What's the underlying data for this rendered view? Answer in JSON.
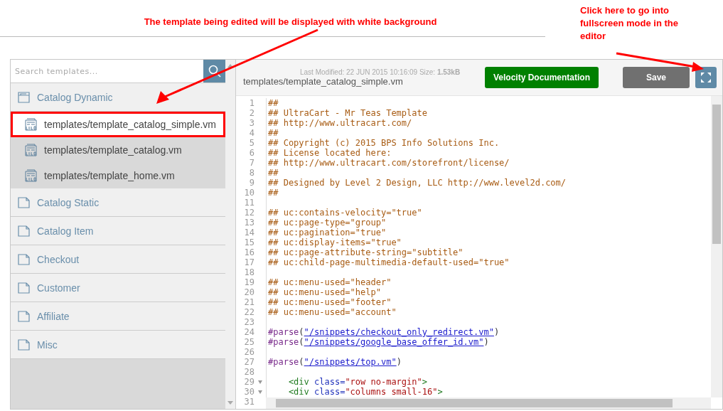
{
  "annotations": [
    {
      "text": "The template being edited will be displayed with white background"
    },
    {
      "text": "Click here to go into fullscreen mode in the editor"
    }
  ],
  "search": {
    "placeholder": "Search templates..."
  },
  "tree": [
    {
      "label": "Catalog Dynamic",
      "expanded": true,
      "children": [
        {
          "label": "templates/template_catalog_simple.vm",
          "selected": true,
          "annotated": true
        },
        {
          "label": "templates/template_catalog.vm",
          "selected": false,
          "annotated": false
        },
        {
          "label": "templates/template_home.vm",
          "selected": false,
          "annotated": false
        }
      ]
    },
    {
      "label": "Catalog Static",
      "expanded": false
    },
    {
      "label": "Catalog Item",
      "expanded": false
    },
    {
      "label": "Checkout",
      "expanded": false
    },
    {
      "label": "Customer",
      "expanded": false
    },
    {
      "label": "Affiliate",
      "expanded": false
    },
    {
      "label": "Misc",
      "expanded": false
    }
  ],
  "editor": {
    "path": "templates/template_catalog_simple.vm",
    "meta": "Last Modified: 22 JUN 2015 10:16:09  Size: **1.53kB**",
    "buttons": [
      {
        "label": "Velocity Documentation",
        "kind": "primary"
      },
      {
        "label": "Save",
        "kind": "secondary"
      }
    ],
    "lines": [
      {
        "number": "1",
        "fold": false,
        "segments": [
          {
            "kind": "comment",
            "text": "##"
          }
        ]
      },
      {
        "number": "2",
        "fold": false,
        "segments": [
          {
            "kind": "comment",
            "text": "## UltraCart - Mr Teas Template"
          }
        ]
      },
      {
        "number": "3",
        "fold": false,
        "segments": [
          {
            "kind": "comment",
            "text": "## http://www.ultracart.com/"
          }
        ]
      },
      {
        "number": "4",
        "fold": false,
        "segments": [
          {
            "kind": "comment",
            "text": "##"
          }
        ]
      },
      {
        "number": "5",
        "fold": false,
        "segments": [
          {
            "kind": "comment",
            "text": "## Copyright (c) 2015 BPS Info Solutions Inc."
          }
        ]
      },
      {
        "number": "6",
        "fold": false,
        "segments": [
          {
            "kind": "comment",
            "text": "## License located here:"
          }
        ]
      },
      {
        "number": "7",
        "fold": false,
        "segments": [
          {
            "kind": "comment",
            "text": "## http://www.ultracart.com/storefront/license/"
          }
        ]
      },
      {
        "number": "8",
        "fold": false,
        "segments": [
          {
            "kind": "comment",
            "text": "##"
          }
        ]
      },
      {
        "number": "9",
        "fold": false,
        "segments": [
          {
            "kind": "comment",
            "text": "## Designed by Level 2 Design, LLC http://www.level2d.com/"
          }
        ]
      },
      {
        "number": "10",
        "fold": false,
        "segments": [
          {
            "kind": "comment",
            "text": "##"
          }
        ]
      },
      {
        "number": "11",
        "fold": false
      },
      {
        "number": "12",
        "fold": false,
        "segments": [
          {
            "kind": "comment",
            "text": "## uc:contains-velocity=\"true\""
          }
        ]
      },
      {
        "number": "13",
        "fold": false,
        "segments": [
          {
            "kind": "comment",
            "text": "## uc:page-type=\"group\""
          }
        ]
      },
      {
        "number": "14",
        "fold": false,
        "segments": [
          {
            "kind": "comment",
            "text": "## uc:pagination=\"true\""
          }
        ]
      },
      {
        "number": "15",
        "fold": false,
        "segments": [
          {
            "kind": "comment",
            "text": "## uc:display-items=\"true\""
          }
        ]
      },
      {
        "number": "16",
        "fold": false,
        "segments": [
          {
            "kind": "comment",
            "text": "## uc:page-attribute-string=\"subtitle\""
          }
        ]
      },
      {
        "number": "17",
        "fold": false,
        "segments": [
          {
            "kind": "comment",
            "text": "## uc:child-page-multimedia-default-used=\"true\""
          }
        ]
      },
      {
        "number": "18",
        "fold": false
      },
      {
        "number": "19",
        "fold": false,
        "segments": [
          {
            "kind": "comment",
            "text": "## uc:menu-used=\"header\""
          }
        ]
      },
      {
        "number": "20",
        "fold": false,
        "segments": [
          {
            "kind": "comment",
            "text": "## uc:menu-used=\"help\""
          }
        ]
      },
      {
        "number": "21",
        "fold": false,
        "segments": [
          {
            "kind": "comment",
            "text": "## uc:menu-used=\"footer\""
          }
        ]
      },
      {
        "number": "22",
        "fold": false,
        "segments": [
          {
            "kind": "comment",
            "text": "## uc:menu-used=\"account\""
          }
        ]
      },
      {
        "number": "23",
        "fold": false
      },
      {
        "number": "24",
        "fold": false,
        "segments": [
          {
            "kind": "directive",
            "text": "#parse"
          },
          {
            "kind": "plain",
            "text": "("
          },
          {
            "kind": "link",
            "text": "\"/snippets/checkout_only_redirect.vm\""
          },
          {
            "kind": "plain",
            "text": ")"
          }
        ]
      },
      {
        "number": "25",
        "fold": false,
        "segments": [
          {
            "kind": "directive",
            "text": "#parse"
          },
          {
            "kind": "plain",
            "text": "("
          },
          {
            "kind": "link",
            "text": "\"/snippets/google_base_offer_id.vm\""
          },
          {
            "kind": "plain",
            "text": ")"
          }
        ]
      },
      {
        "number": "26",
        "fold": false
      },
      {
        "number": "27",
        "fold": false,
        "segments": [
          {
            "kind": "directive",
            "text": "#parse"
          },
          {
            "kind": "plain",
            "text": "("
          },
          {
            "kind": "link",
            "text": "\"/snippets/top.vm\""
          },
          {
            "kind": "plain",
            "text": ")"
          }
        ]
      },
      {
        "number": "28",
        "fold": false
      },
      {
        "number": "29",
        "fold": true,
        "indented": true,
        "segments": [
          {
            "kind": "tag",
            "text": "<div"
          },
          {
            "kind": "attr",
            "text": "class="
          },
          {
            "kind": "string",
            "text": "\"row no-margin\""
          },
          {
            "kind": "tag",
            "text": ">"
          }
        ]
      },
      {
        "number": "30",
        "fold": true,
        "indented": true,
        "segments": [
          {
            "kind": "tag",
            "text": "<div"
          },
          {
            "kind": "attr",
            "text": "class="
          },
          {
            "kind": "string",
            "text": "\"columns small-16\""
          },
          {
            "kind": "tag",
            "text": ">"
          }
        ]
      },
      {
        "number": "31",
        "fold": false
      }
    ]
  }
}
